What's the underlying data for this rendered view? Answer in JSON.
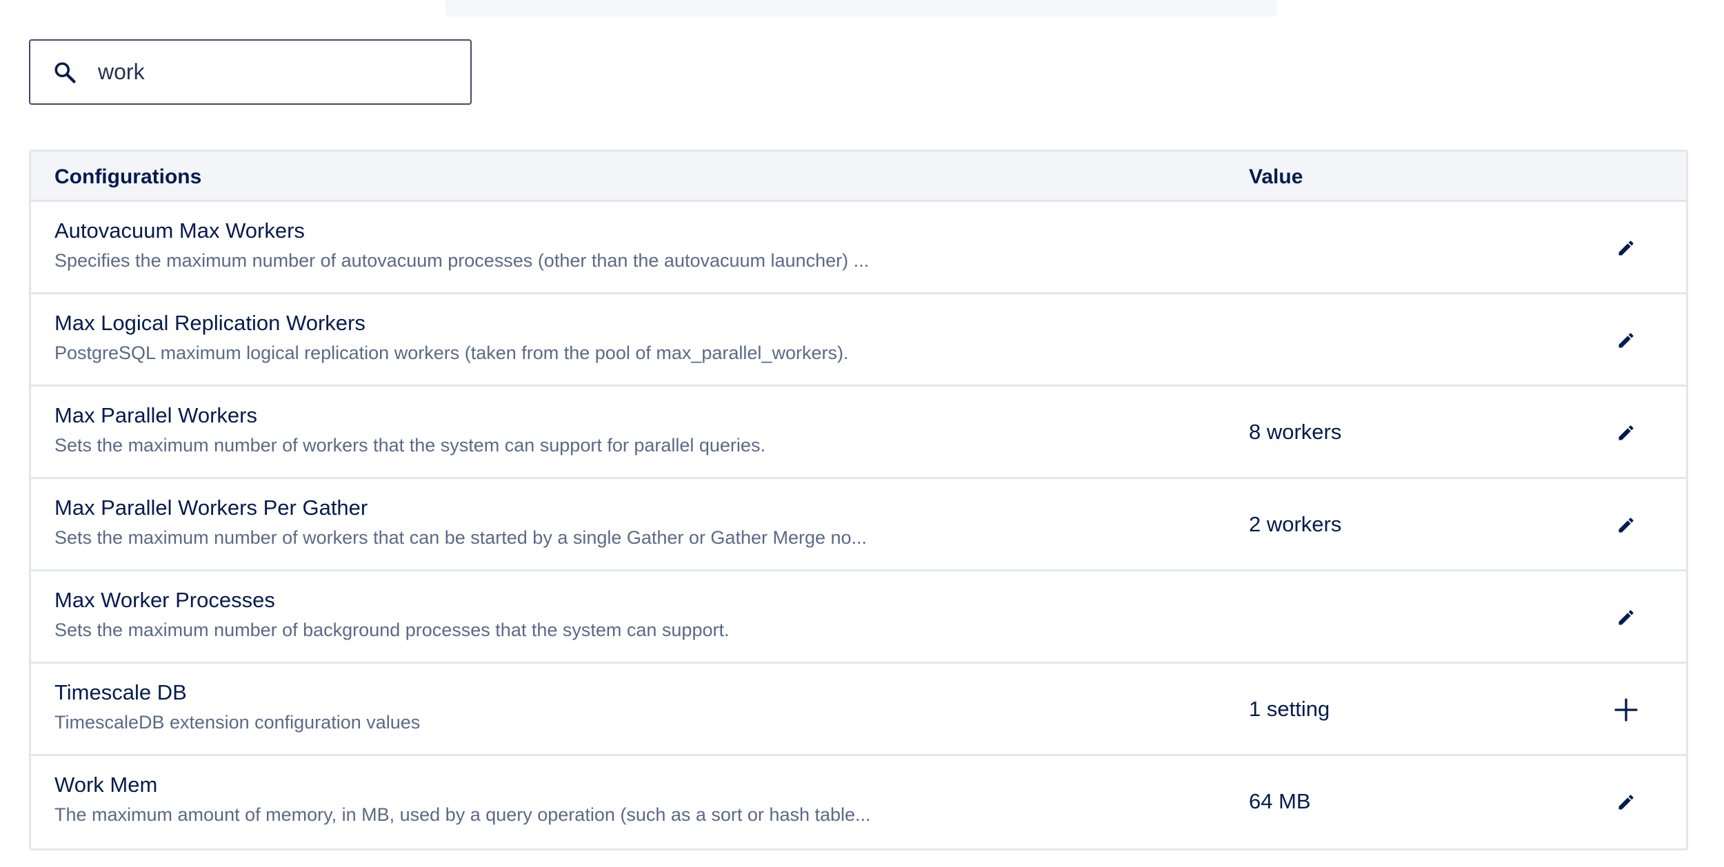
{
  "search": {
    "value": "work",
    "icon": "search-icon"
  },
  "table": {
    "headers": {
      "configurations": "Configurations",
      "value": "Value"
    },
    "rows": [
      {
        "name": "Autovacuum Max Workers",
        "description": "Specifies the maximum number of autovacuum processes (other than the autovacuum launcher) ...",
        "value": "",
        "action_icon": "pencil-icon"
      },
      {
        "name": "Max Logical Replication Workers",
        "description": "PostgreSQL maximum logical replication workers (taken from the pool of max_parallel_workers).",
        "value": "",
        "action_icon": "pencil-icon"
      },
      {
        "name": "Max Parallel Workers",
        "description": "Sets the maximum number of workers that the system can support for parallel queries.",
        "value": "8 workers",
        "action_icon": "pencil-icon"
      },
      {
        "name": "Max Parallel Workers Per Gather",
        "description": "Sets the maximum number of workers that can be started by a single Gather or Gather Merge no...",
        "value": "2 workers",
        "action_icon": "pencil-icon"
      },
      {
        "name": "Max Worker Processes",
        "description": "Sets the maximum number of background processes that the system can support.",
        "value": "",
        "action_icon": "pencil-icon"
      },
      {
        "name": "Timescale DB",
        "description": "TimescaleDB extension configuration values",
        "value": "1 setting",
        "action_icon": "plus-icon"
      },
      {
        "name": "Work Mem",
        "description": "The maximum amount of memory, in MB, used by a query operation (such as a sort or hash table...",
        "value": "64 MB",
        "action_icon": "pencil-icon"
      }
    ]
  },
  "colors": {
    "text": "#031b4e",
    "muted": "#5b6987",
    "border": "#e3e6ec",
    "header_bg": "#f3f5f8"
  }
}
